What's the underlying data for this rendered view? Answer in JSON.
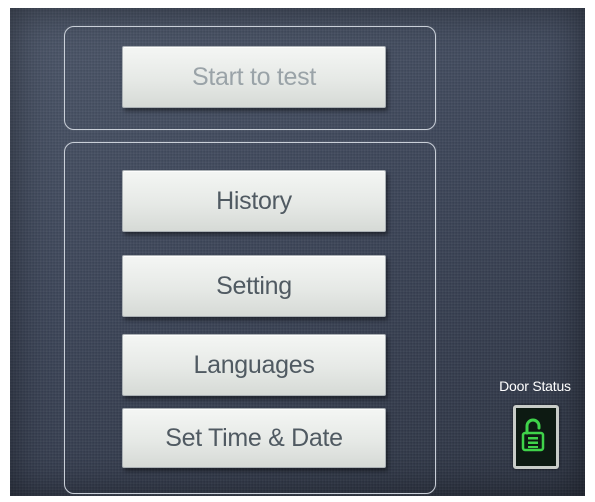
{
  "top_panel": {
    "start_label": "Start to test"
  },
  "menu": {
    "history_label": "History",
    "setting_label": "Setting",
    "languages_label": "Languages",
    "set_time_date_label": "Set Time & Date"
  },
  "door_status": {
    "label": "Door Status",
    "icon": "unlocked-padlock-icon",
    "icon_color": "#3fd34a"
  },
  "colors": {
    "screen_background": "#3c4558",
    "button_face": "#e6e9e6",
    "button_text": "#505a62",
    "panel_border": "#c9cfd8"
  }
}
